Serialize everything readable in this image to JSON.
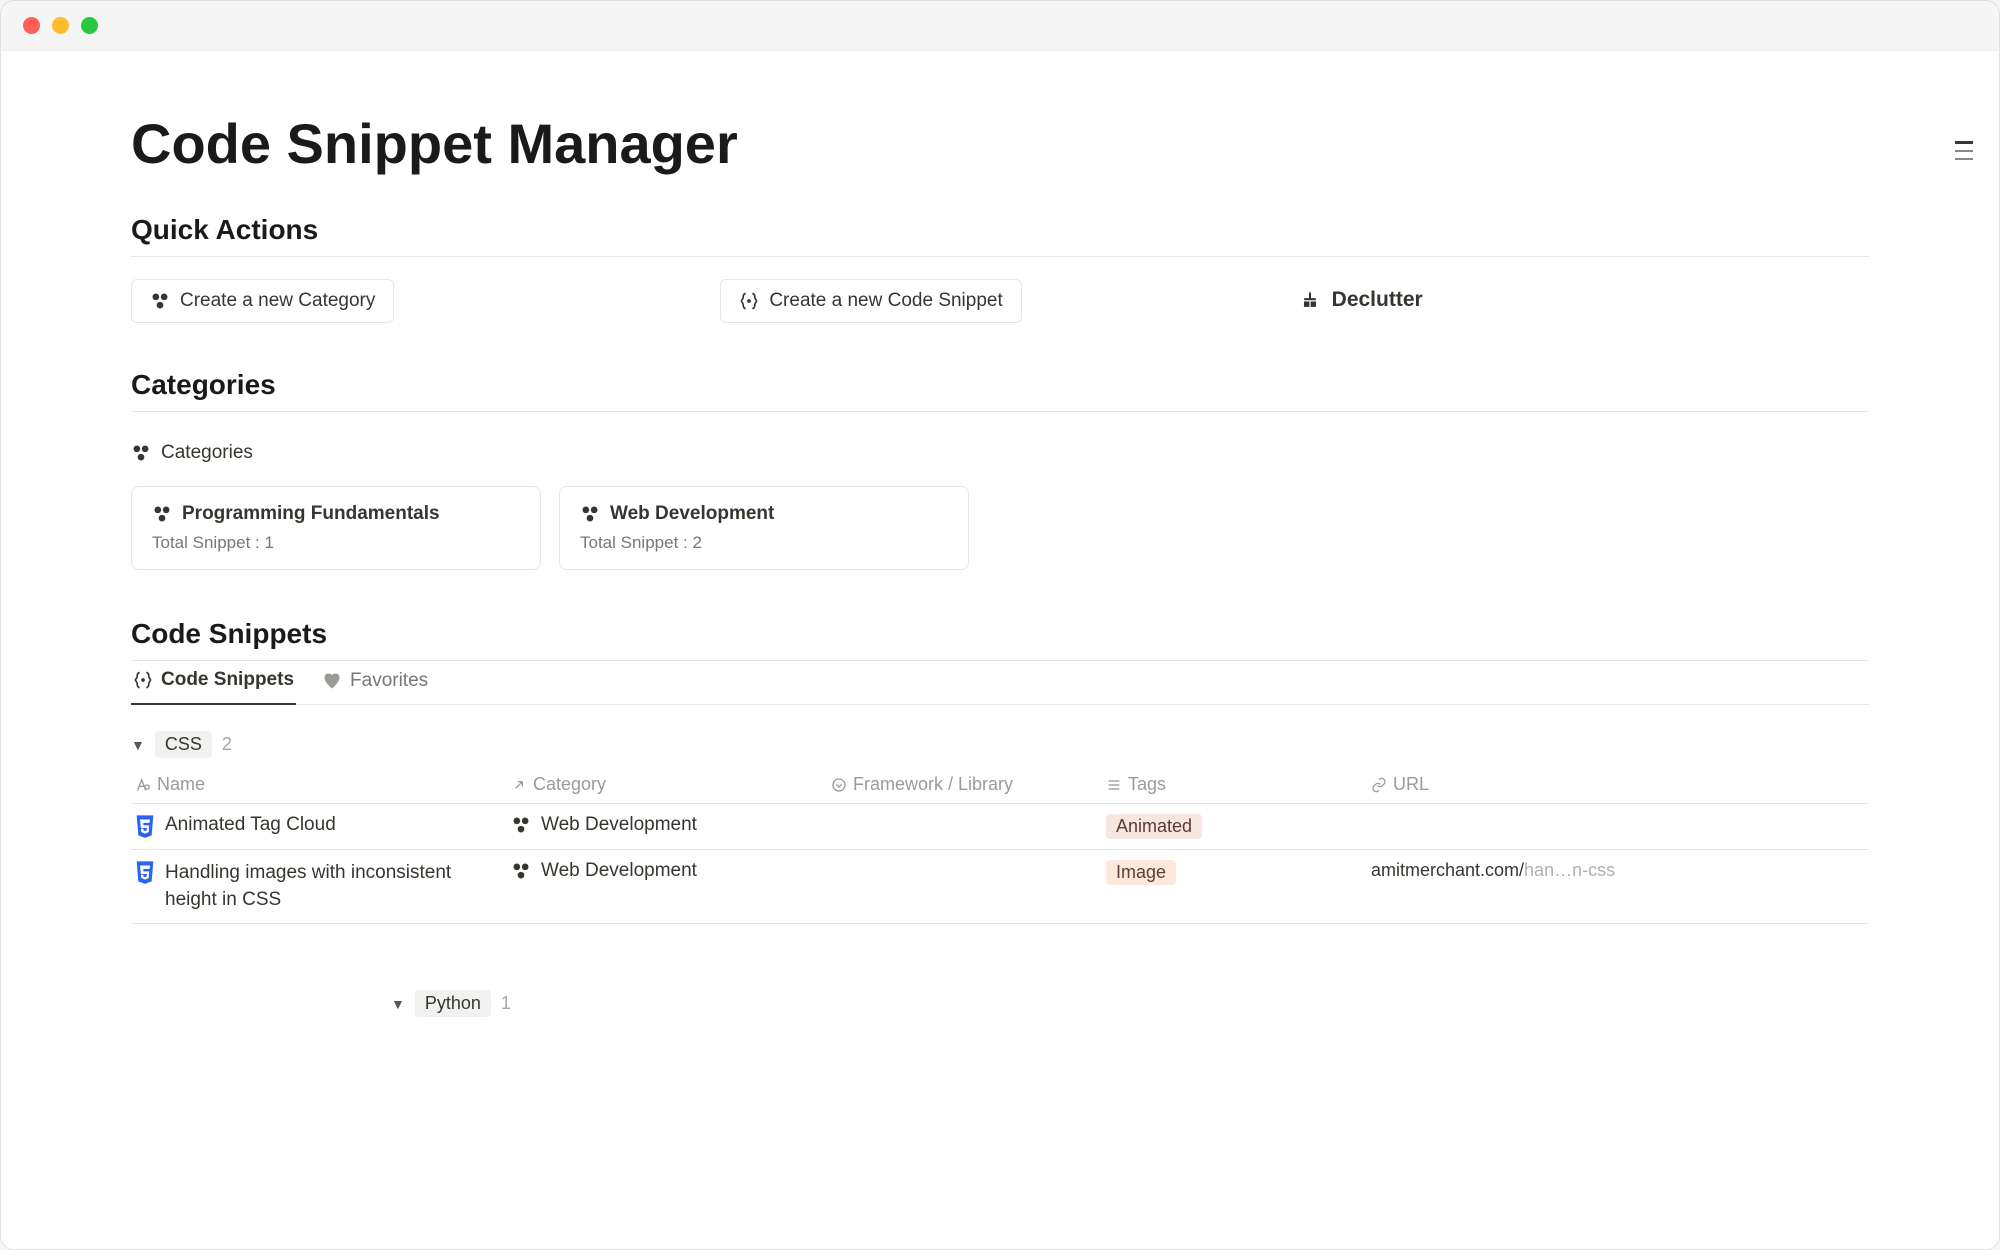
{
  "page": {
    "title": "Code Snippet Manager"
  },
  "sections": {
    "quick_actions": "Quick Actions",
    "categories": "Categories",
    "code_snippets": "Code Snippets"
  },
  "actions": {
    "create_category": "Create a new Category",
    "create_snippet": "Create a new Code Snippet",
    "declutter": "Declutter"
  },
  "categories_tab": {
    "label": "Categories"
  },
  "category_cards": [
    {
      "title": "Programming Fundamentals",
      "subtitle": "Total Snippet : 1"
    },
    {
      "title": "Web Development",
      "subtitle": "Total Snippet : 2"
    }
  ],
  "snippet_tabs": {
    "code_snippets": "Code Snippets",
    "favorites": "Favorites"
  },
  "groups": {
    "css": {
      "label": "CSS",
      "count": "2"
    },
    "python": {
      "label": "Python",
      "count": "1"
    }
  },
  "columns": {
    "name": "Name",
    "category": "Category",
    "framework": "Framework / Library",
    "tags": "Tags",
    "url": "URL"
  },
  "rows": [
    {
      "name": "Animated Tag Cloud",
      "category": "Web Development",
      "framework": "",
      "tag": "Animated",
      "tag_class": "tag-animated",
      "url_main": "",
      "url_gray": ""
    },
    {
      "name": "Handling images with inconsistent height in CSS",
      "category": "Web Development",
      "framework": "",
      "tag": "Image",
      "tag_class": "tag-image",
      "url_main": "amitmerchant.com/",
      "url_gray": "han…n-css"
    }
  ]
}
